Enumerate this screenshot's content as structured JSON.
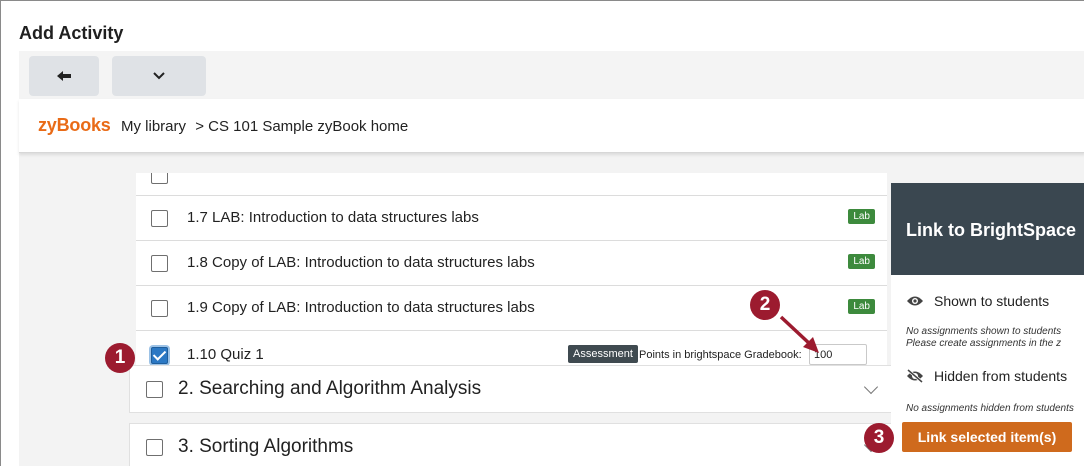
{
  "window": {
    "title": "Add Activity"
  },
  "toolbar": {
    "back_icon": "arrow-left-icon",
    "menu_icon": "chevron-down-icon"
  },
  "header": {
    "logo": "zyBooks",
    "breadcrumb": [
      "My library",
      ">",
      "CS 101 Sample zyBook home"
    ]
  },
  "sections": [
    {
      "label": "1.7 LAB: Introduction to data structures labs",
      "checked": false,
      "badge": "Lab"
    },
    {
      "label": "1.8 Copy of LAB: Introduction to data structures labs",
      "checked": false,
      "badge": "Lab"
    },
    {
      "label": "1.9 Copy of LAB: Introduction to data structures labs",
      "checked": false,
      "badge": "Lab"
    },
    {
      "label": "1.10 Quiz 1",
      "checked": true,
      "badge": "Assessment",
      "points_label": "Points in brightspace Gradebook:",
      "points_value": "100"
    }
  ],
  "chapters": [
    {
      "label": "2. Searching and Algorithm Analysis",
      "checked": false
    },
    {
      "label": "3. Sorting Algorithms",
      "checked": false
    }
  ],
  "side_panel": {
    "title": "Link to BrightSpace",
    "shown_label": "Shown to students",
    "shown_note_1": "No assignments shown to students",
    "shown_note_2": "Please create assignments in the z",
    "hidden_label": "Hidden from students",
    "hidden_note": "No assignments hidden from students",
    "link_button": "Link selected item(s)"
  },
  "callouts": [
    "1",
    "2",
    "3"
  ],
  "colors": {
    "brand_orange": "#e96b17",
    "link_button": "#cf6a1d",
    "lab_badge": "#3d8a3d",
    "assessment_badge": "#3f4a50",
    "panel_header": "#3a4750",
    "callout": "#9c1b2f",
    "checkbox_checked": "#2b78c4"
  }
}
